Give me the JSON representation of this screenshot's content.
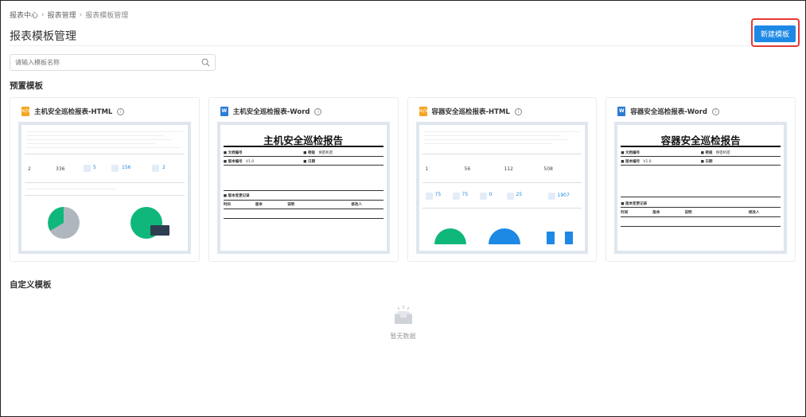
{
  "breadcrumb": {
    "items": [
      "报表中心",
      "报表管理",
      "报表模板管理"
    ]
  },
  "page": {
    "title": "报表模板管理",
    "new_button": "新建模板"
  },
  "search": {
    "placeholder": "请输入模板名称"
  },
  "sections": {
    "preset": "预置模板",
    "custom": "自定义模板"
  },
  "cards": [
    {
      "type": "HTML",
      "icon": "html-file-icon",
      "title": "主机安全巡检报表-HTML",
      "preview": {
        "stats": [
          "2",
          "336",
          "5",
          "156",
          "2"
        ]
      }
    },
    {
      "type": "Word",
      "icon": "word-file-icon",
      "title": "主机安全巡检报表-Word",
      "preview": {
        "doc_title": "主机安全巡检报告",
        "row1": [
          "文档编号",
          "密级",
          "保密机密"
        ],
        "row2": [
          "版本编号",
          "V1.0",
          "日期"
        ],
        "history": "版本变更记录",
        "cols": [
          "时间",
          "版本",
          "说明",
          "修改人"
        ]
      }
    },
    {
      "type": "HTML",
      "icon": "html-file-icon",
      "title": "容器安全巡检报表-HTML",
      "preview": {
        "stats": [
          "1",
          "56",
          "112",
          "508"
        ],
        "stats2": [
          "75",
          "75",
          "0",
          "25",
          "1907"
        ]
      }
    },
    {
      "type": "Word",
      "icon": "word-file-icon",
      "title": "容器安全巡检报表-Word",
      "preview": {
        "doc_title": "容器安全巡检报告",
        "row1": [
          "文档编号",
          "密级",
          "保密机密"
        ],
        "row2": [
          "版本编号",
          "V1.0",
          "日期"
        ],
        "history": "版本变更记录",
        "cols": [
          "时间",
          "版本",
          "说明",
          "修改人"
        ]
      }
    }
  ],
  "empty": {
    "text": "暂无数据"
  },
  "colors": {
    "primary": "#1e88e5",
    "highlight": "#e53935",
    "green": "#0fb87a",
    "gray": "#b0b6bd",
    "html_icon": "#f5a623",
    "word_icon": "#2b7cd3"
  }
}
